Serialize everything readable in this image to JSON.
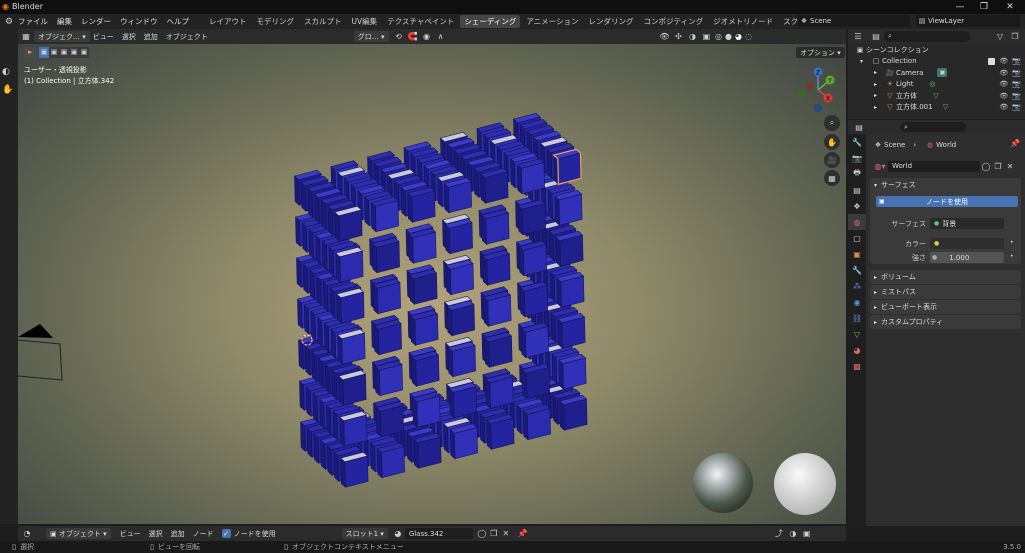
{
  "titlebar": {
    "title": "Blender",
    "minimize": "—",
    "maximize": "❐",
    "close": "✕"
  },
  "menubar": {
    "menus": [
      "ファイル",
      "編集",
      "レンダー",
      "ウィンドウ",
      "ヘルプ"
    ],
    "workspaces": [
      "レイアウト",
      "モデリング",
      "スカルプト",
      "UV編集",
      "テクスチャペイント",
      "シェーディング",
      "アニメーション",
      "レンダリング",
      "コンポジティング",
      "ジオメトリノード",
      "スクリプト作成"
    ],
    "active_workspace": "シェーディング",
    "add_tab": "+",
    "scene": "Scene",
    "view_layer": "ViewLayer"
  },
  "viewport_header": {
    "mode": "オブジェク…",
    "menus": [
      "ビュー",
      "選択",
      "追加",
      "オブジェクト"
    ],
    "transform": "グロ…",
    "options": "オプション"
  },
  "viewport": {
    "overlay_line1": "ユーザー・透視投影",
    "overlay_line2": "(1) Collection | 立方体.342",
    "gizmo_axes": [
      "Z",
      "Y",
      "X"
    ]
  },
  "shader_header": {
    "mode": "オブジェクト",
    "menus": [
      "ビュー",
      "選択",
      "追加",
      "ノード"
    ],
    "use_nodes_label": "ノードを使用",
    "slot": "スロット1",
    "material": "Glass.342"
  },
  "statusbar": {
    "items": [
      "選択",
      "ビューを回転",
      "オブジェクトコンテキストメニュー"
    ],
    "version": "3.5.0"
  },
  "outliner": {
    "root": "シーンコレクション",
    "collection": "Collection",
    "items": [
      "Camera",
      "Light",
      "立方体",
      "立方体.001"
    ]
  },
  "properties": {
    "breadcrumb_scene": "Scene",
    "breadcrumb_world": "World",
    "world_name": "World",
    "surface_panel": "サーフェス",
    "use_nodes_button": "ノードを使用",
    "surface_label": "サーフェス",
    "surface_value": "背景",
    "color_label": "カラー",
    "strength_label": "強さ",
    "strength_value": "1.000",
    "panels": [
      "ボリューム",
      "ミストパス",
      "ビューポート表示",
      "カスタムプロパティ"
    ]
  },
  "colors": {
    "accent_blue": "#4772b3",
    "active_orange": "#f0a050",
    "cube_blue": "#2a2aa8"
  }
}
